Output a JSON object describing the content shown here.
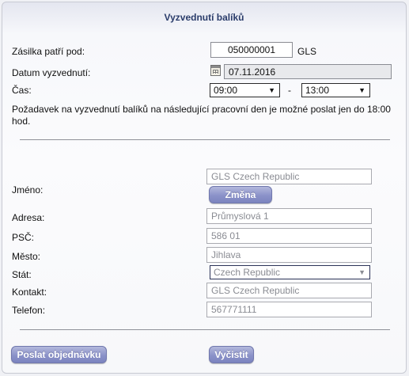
{
  "title": "Vyzvednutí balíků",
  "shipment": {
    "label": "Zásilka patří pod:",
    "value": "050000001",
    "carrier": "GLS"
  },
  "pickup_date": {
    "label": "Datum vyzvednutí:",
    "value": "07.11.2016",
    "icon": "calendar-icon"
  },
  "time": {
    "label": "Čas:",
    "from": "09:00",
    "separator": "-",
    "to": "13:00"
  },
  "notice": "Požadavek na vyzvednutí balíků na následující pracovní den je možné poslat jen do 18:00 hod.",
  "address": {
    "name_label": "Jméno:",
    "name_value": "GLS Czech Republic",
    "change_button": "Změna",
    "street_label": "Adresa:",
    "street_value": "Průmyslová 1",
    "zip_label": "PSČ:",
    "zip_value": "586 01",
    "city_label": "Město:",
    "city_value": "Jihlava",
    "country_label": "Stát:",
    "country_value": "Czech Republic",
    "contact_label": "Kontakt:",
    "contact_value": "GLS Czech Republic",
    "phone_label": "Telefon:",
    "phone_value": "567771111"
  },
  "buttons": {
    "submit": "Poslat objednávku",
    "clear": "Vyčistit"
  }
}
